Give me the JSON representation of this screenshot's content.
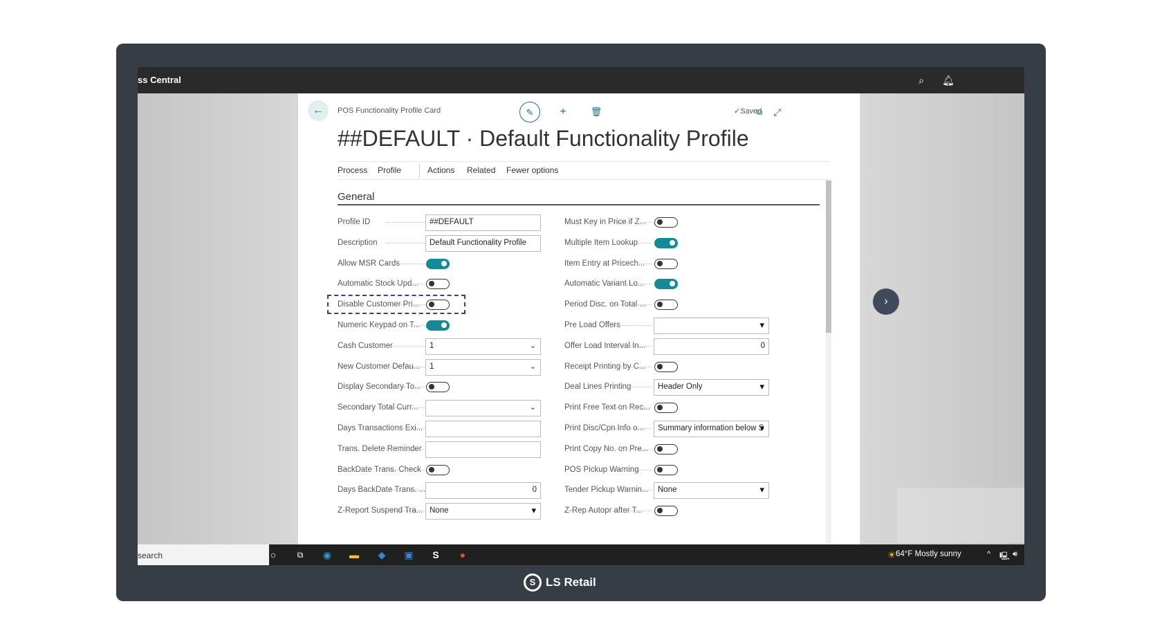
{
  "app": {
    "title": "ss Central"
  },
  "header": {
    "breadcrumb": "POS Functionality Profile Card",
    "saved": "✓Saved",
    "page_title": "##DEFAULT · Default Functionality Profile"
  },
  "tabs": [
    "Process",
    "Profile",
    "Actions",
    "Related",
    "Fewer options"
  ],
  "section": "General",
  "left_fields": [
    {
      "label": "Profile ID",
      "type": "text",
      "value": "##DEFAULT"
    },
    {
      "label": "Description",
      "type": "text",
      "value": "Default Functionality Profile"
    },
    {
      "label": "Allow MSR Cards",
      "type": "toggle",
      "on": true
    },
    {
      "label": "Automatic Stock Upd...",
      "type": "toggle",
      "on": false
    },
    {
      "label": "Disable Customer Pri...",
      "type": "toggle",
      "on": false
    },
    {
      "label": "Numeric Keypad on T...",
      "type": "toggle",
      "on": true
    },
    {
      "label": "Cash Customer",
      "type": "select",
      "value": "1"
    },
    {
      "label": "New Customer Defau...",
      "type": "select",
      "value": "1"
    },
    {
      "label": "Display Secondary To...",
      "type": "toggle",
      "on": false
    },
    {
      "label": "Secondary Total Curr...",
      "type": "select",
      "value": ""
    },
    {
      "label": "Days Transactions Exi...",
      "type": "text",
      "value": ""
    },
    {
      "label": "Trans. Delete Reminder",
      "type": "text",
      "value": ""
    },
    {
      "label": "BackDate Trans. Check",
      "type": "toggle",
      "on": false
    },
    {
      "label": "Days BackDate Trans. ...",
      "type": "number",
      "value": "0"
    },
    {
      "label": "Z-Report Suspend Tra...",
      "type": "dropdown",
      "value": "None"
    }
  ],
  "right_fields": [
    {
      "label": "Must Key in Price if Z...",
      "type": "toggle",
      "on": false
    },
    {
      "label": "Multiple Item Lookup",
      "type": "toggle",
      "on": true
    },
    {
      "label": "Item Entry at Pricech...",
      "type": "toggle",
      "on": false
    },
    {
      "label": "Automatic Variant Lo...",
      "type": "toggle",
      "on": true
    },
    {
      "label": "Period Disc. on Total ...",
      "type": "toggle",
      "on": false
    },
    {
      "label": "Pre Load Offers",
      "type": "dropdown",
      "value": ""
    },
    {
      "label": "Offer Load Interval In...",
      "type": "number",
      "value": "0"
    },
    {
      "label": "Receipt Printing by C...",
      "type": "toggle",
      "on": false
    },
    {
      "label": "Deal Lines Printing",
      "type": "dropdown",
      "value": "Header Only"
    },
    {
      "label": "Print Free Text on Rec...",
      "type": "toggle",
      "on": false
    },
    {
      "label": "Print Disc/Cpn Info o...",
      "type": "dropdown",
      "value": "Summary information below S"
    },
    {
      "label": "Print Copy No. on Pre...",
      "type": "toggle",
      "on": false
    },
    {
      "label": "POS Pickup Warning",
      "type": "toggle",
      "on": false
    },
    {
      "label": "Tender Pickup Warnin...",
      "type": "dropdown",
      "value": "None"
    },
    {
      "label": "Z-Rep Autopr after T...",
      "type": "toggle",
      "on": false
    }
  ],
  "taskbar": {
    "search": "search",
    "weather": "64°F  Mostly sunny"
  },
  "brand": "LS Retail",
  "colors": {
    "accent": "#138a96",
    "frame": "#363d44",
    "highlight": "#5e2d7c"
  }
}
